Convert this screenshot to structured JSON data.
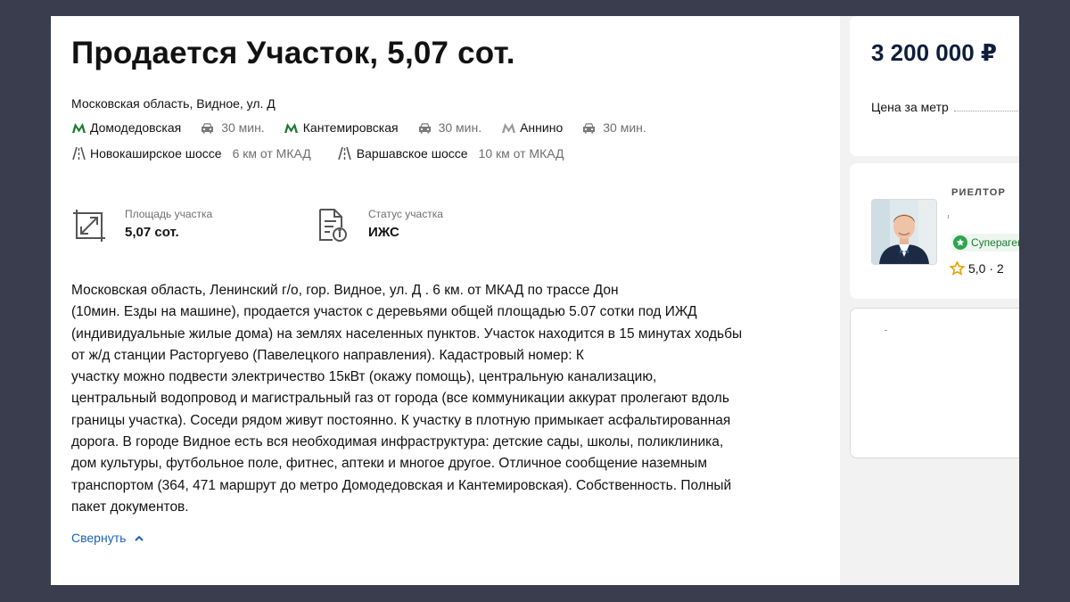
{
  "listing": {
    "title": "Продается Участок, 5,07 сот.",
    "address": "Московская область, Видное, ул. Д",
    "metro": [
      {
        "name": "Домодедовская",
        "time": "30 мин.",
        "color": "#1a7a2e"
      },
      {
        "name": "Кантемировская",
        "time": "30 мин.",
        "color": "#1a7a2e"
      },
      {
        "name": "Аннино",
        "time": "30 мин.",
        "color": "#9a9a9a"
      }
    ],
    "highways": [
      {
        "name": "Новокаширское шоссе",
        "distance": "6 км от МКАД"
      },
      {
        "name": "Варшавское шоссе",
        "distance": "10 км от МКАД"
      }
    ],
    "features": [
      {
        "label": "Площадь участка",
        "value": "5,07 сот.",
        "icon": "area-icon"
      },
      {
        "label": "Статус участка",
        "value": "ИЖС",
        "icon": "document-status-icon"
      }
    ],
    "description_lines": [
      "Московская область, Ленинский г/о, гор. Видное, ул. Д                          . 6 км. от МКАД по трассе Дон",
      "(10мин. Езды на машине), продается участок с деревьями общей площадью 5.07 сотки под ИЖД",
      "(индивидуальные жилые дома) на землях населенных пунктов. Участок находится в 15 минутах ходьбы",
      "от ж/д станции Расторгуево (Павелецкого направления). Кадастровый номер:                              К",
      "участку можно подвести электричество 15кВт (окажу помощь), центральную канализацию,",
      "центральный водопровод и магистральный газ от города (все коммуникации аккурат пролегают вдоль",
      "границы участка). Соседи рядом живут постоянно. К участку в плотную примыкает асфальтированная",
      "дорога. В городе Видное есть вся необходимая инфраструктура: детские сады, школы, поликлиника,",
      "дом культуры, футбольное поле, фитнес, аптеки и многое другое. Отличное сообщение наземным",
      "транспортом (364, 471 маршрут до метро Домодедовская и Кантемировская). Собственность. Полный",
      "пакет документов."
    ],
    "collapse_label": "Свернуть"
  },
  "sidebar": {
    "price": "3 200 000 ₽",
    "price_per_meter_label": "Цена за метр",
    "agent": {
      "role": "РИЕЛТОР",
      "badge": "Суперагент",
      "rating": "5,0 · 2"
    }
  },
  "colors": {
    "link": "#1c62b6",
    "metro_green": "#1a7a2e",
    "frame": "#3a3d4e"
  }
}
